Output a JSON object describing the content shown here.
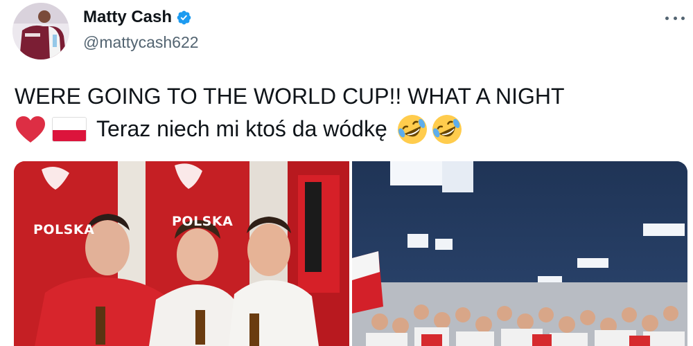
{
  "author": {
    "display_name": "Matty Cash",
    "handle": "@mattycash622",
    "verified": true,
    "avatar_icon": "profile-photo",
    "verified_icon": "verified-badge-icon"
  },
  "menu": {
    "icon": "more-horizontal-icon"
  },
  "tweet": {
    "line1": "WERE GOING TO THE WORLD CUP!! WHAT A NIGHT",
    "line2_text": "Teraz niech mi ktoś da wódkę",
    "emoji": [
      "red-heart",
      "poland-flag",
      "rolling-on-the-floor-laughing",
      "rolling-on-the-floor-laughing"
    ]
  },
  "media": {
    "count": 2,
    "photos": [
      {
        "name": "locker-room-three-players",
        "wall_text": "POLSKA"
      },
      {
        "name": "team-celebration-dressing-room"
      }
    ]
  },
  "colors": {
    "text_primary": "#0f1419",
    "text_secondary": "#536471",
    "verified_blue": "#1d9bf0",
    "poland_red": "#dc143c"
  }
}
